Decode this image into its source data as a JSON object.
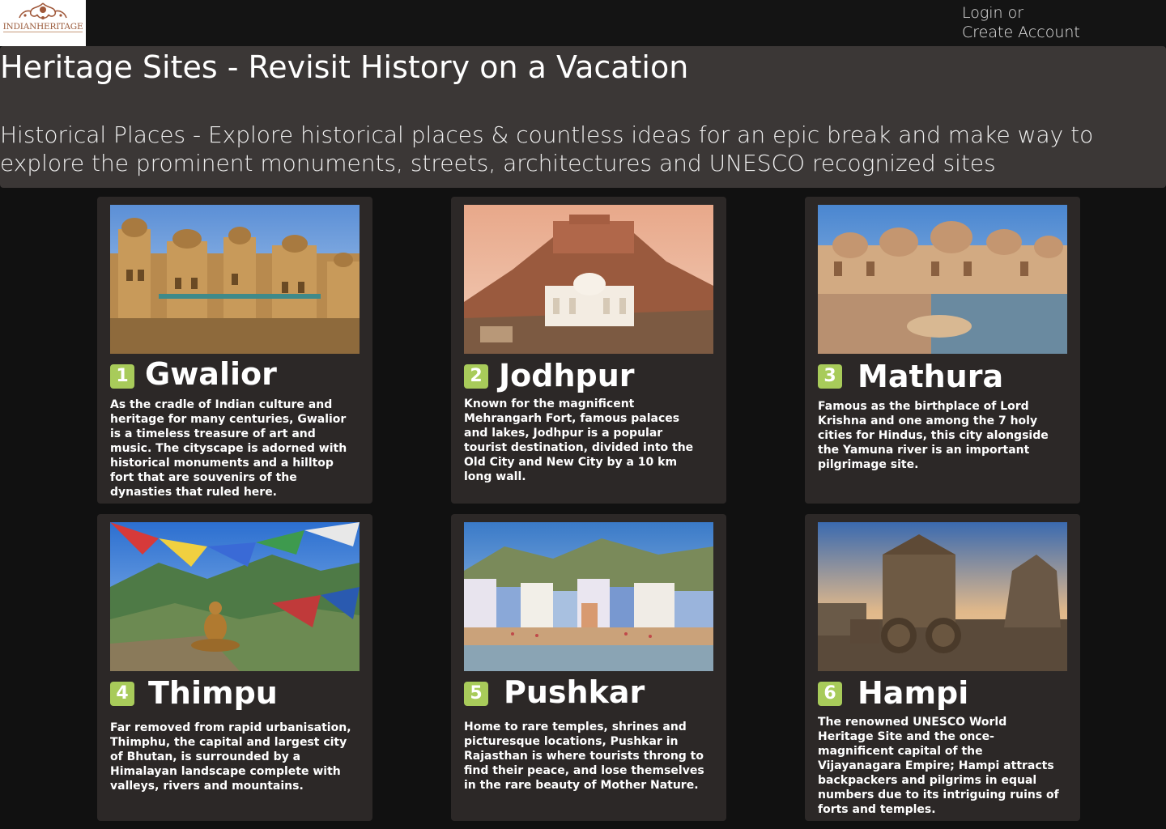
{
  "header": {
    "logo_text": "INDIANHERITAGE",
    "login_label": "Login or",
    "create_account_label": "Create Account"
  },
  "hero": {
    "title": "Heritage Sites - Revisit History on a Vacation",
    "subtitle": "Historical Places - Explore historical places & countless ideas for an epic break and make way to explore the prominent monuments, streets, architectures and UNESCO recognized sites"
  },
  "colors": {
    "background": "#111111",
    "hero_panel": "#3b3736",
    "card": "#2c2827",
    "badge": "#a8cb5a"
  },
  "places": [
    {
      "number": "1",
      "name": "Gwalior",
      "image_icon": "fort-photo",
      "description": "As the cradle of Indian culture and heritage for many centuries, Gwalior is a timeless treasure of art and music. The cityscape is adorned with historical monuments and a hilltop fort that are souvenirs of the dynasties that ruled here."
    },
    {
      "number": "2",
      "name": "Jodhpur",
      "image_icon": "fort-on-hill-photo",
      "description": "Known for the magnificent Mehrangarh Fort, famous palaces and lakes, Jodhpur is a popular tourist destination, divided into the Old City and New City by a 10 km long wall."
    },
    {
      "number": "3",
      "name": "Mathura",
      "image_icon": "temple-lake-photo",
      "description": "Famous as the birthplace of Lord Krishna and one among the 7 holy cities for Hindus, this city alongside the Yamuna river is an important pilgrimage site."
    },
    {
      "number": "4",
      "name": "Thimpu",
      "image_icon": "buddha-prayer-flags-photo",
      "description": "Far removed from rapid urbanisation, Thimphu, the capital and largest city of Bhutan, is surrounded by a Himalayan landscape complete with valleys, rivers and mountains."
    },
    {
      "number": "5",
      "name": "Pushkar",
      "image_icon": "lakeside-town-photo",
      "description": "Home to rare temples, shrines and picturesque locations, Pushkar in Rajasthan is where tourists throng to find their peace, and lose themselves in the rare beauty of Mother Nature."
    },
    {
      "number": "6",
      "name": "Hampi",
      "image_icon": "stone-chariot-photo",
      "description": "The renowned UNESCO World Heritage Site and the once-magnificent capital of the Vijayanagara Empire; Hampi attracts backpackers and pilgrims in equal numbers due to its intriguing ruins of forts and temples."
    }
  ]
}
